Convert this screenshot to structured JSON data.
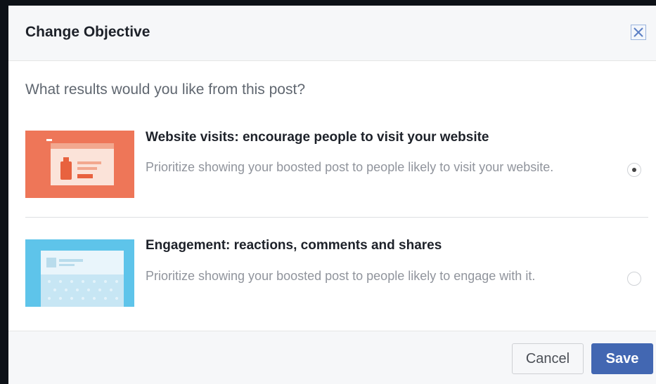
{
  "dialog": {
    "title": "Change Objective",
    "close_icon": "close-x-icon",
    "question": "What results would you like from this post?"
  },
  "options": [
    {
      "title": "Website visits: encourage people to visit your website",
      "description": "Prioritize showing your boosted post to people likely to visit your website.",
      "selected": true,
      "thumbnail_icon": "website-visits-illustration",
      "thumbnail_color": "#ee7658"
    },
    {
      "title": "Engagement: reactions, comments and shares",
      "description": "Prioritize showing your boosted post to people likely to engage with it.",
      "selected": false,
      "thumbnail_icon": "engagement-illustration",
      "thumbnail_color": "#5ec4ea"
    }
  ],
  "footer": {
    "cancel_label": "Cancel",
    "save_label": "Save"
  },
  "colors": {
    "primary": "#4267b2",
    "header_bg": "#f6f7f9"
  }
}
